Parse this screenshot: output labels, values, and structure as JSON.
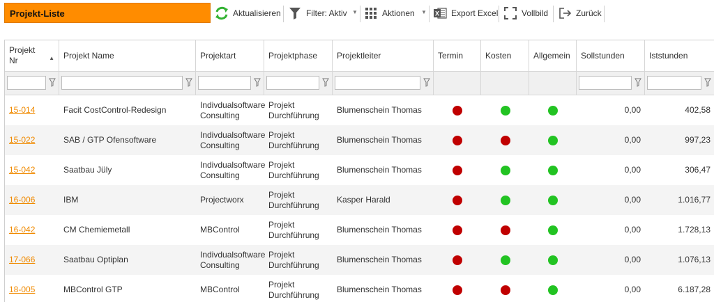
{
  "header": {
    "title": "Projekt-Liste"
  },
  "toolbar": {
    "refresh_label": "Aktualisieren",
    "filter_label": "Filter: Aktiv",
    "actions_label": "Aktionen",
    "excel_label": "Export Excel",
    "fullscreen_label": "Vollbild",
    "back_label": "Zurück"
  },
  "colors": {
    "accent": "#ff8c00",
    "link": "#f08a00",
    "red": "#c00000",
    "green": "#22c322"
  },
  "table": {
    "columns": [
      "Projekt Nr",
      "Projekt Name",
      "Projektart",
      "Projektphase",
      "Projektleiter",
      "Termin",
      "Kosten",
      "Allgemein",
      "Sollstunden",
      "Iststunden"
    ],
    "rows": [
      {
        "nr": "15-014",
        "name": "Facit CostControl-Redesign",
        "art1": "Indivdualsoftware",
        "art2": "Consulting",
        "phase1": "Projekt",
        "phase2": "Durchführung",
        "leiter": "Blumenschein Thomas",
        "termin": "red",
        "kosten": "green",
        "allgemein": "green",
        "soll": "0,00",
        "ist": "402,58"
      },
      {
        "nr": "15-022",
        "name": "SAB / GTP Ofensoftware",
        "art1": "Indivdualsoftware",
        "art2": "Consulting",
        "phase1": "Projekt",
        "phase2": "Durchführung",
        "leiter": "Blumenschein Thomas",
        "termin": "red",
        "kosten": "red",
        "allgemein": "green",
        "soll": "0,00",
        "ist": "997,23"
      },
      {
        "nr": "15-042",
        "name": "Saatbau Jüly",
        "art1": "Indivdualsoftware",
        "art2": "Consulting",
        "phase1": "Projekt",
        "phase2": "Durchführung",
        "leiter": "Blumenschein Thomas",
        "termin": "red",
        "kosten": "green",
        "allgemein": "green",
        "soll": "0,00",
        "ist": "306,47"
      },
      {
        "nr": "16-006",
        "name": "IBM",
        "art1": "Projectworx",
        "art2": "",
        "phase1": "Projekt",
        "phase2": "Durchführung",
        "leiter": "Kasper Harald",
        "termin": "red",
        "kosten": "green",
        "allgemein": "green",
        "soll": "0,00",
        "ist": "1.016,77"
      },
      {
        "nr": "16-042",
        "name": "CM Chemiemetall",
        "art1": "MBControl",
        "art2": "",
        "phase1": "Projekt",
        "phase2": "Durchführung",
        "leiter": "Blumenschein Thomas",
        "termin": "red",
        "kosten": "red",
        "allgemein": "green",
        "soll": "0,00",
        "ist": "1.728,13"
      },
      {
        "nr": "17-066",
        "name": "Saatbau Optiplan",
        "art1": "Indivdualsoftware",
        "art2": "Consulting",
        "phase1": "Projekt",
        "phase2": "Durchführung",
        "leiter": "Blumenschein Thomas",
        "termin": "red",
        "kosten": "green",
        "allgemein": "green",
        "soll": "0,00",
        "ist": "1.076,13"
      },
      {
        "nr": "18-005",
        "name": "MBControl GTP",
        "art1": "MBControl",
        "art2": "",
        "phase1": "Projekt",
        "phase2": "Durchführung",
        "leiter": "Blumenschein Thomas",
        "termin": "red",
        "kosten": "red",
        "allgemein": "green",
        "soll": "0,00",
        "ist": "6.187,28"
      }
    ]
  }
}
